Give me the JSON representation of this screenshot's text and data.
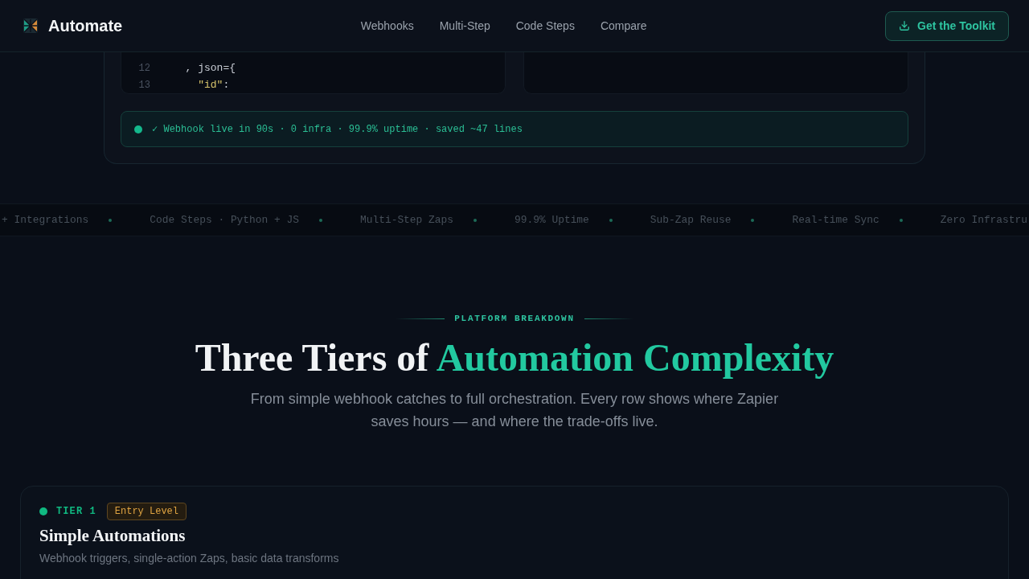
{
  "header": {
    "brand": "Automate",
    "nav": [
      {
        "label": "Webhooks"
      },
      {
        "label": "Multi-Step"
      },
      {
        "label": "Code Steps"
      },
      {
        "label": "Compare"
      }
    ],
    "cta": "Get the Toolkit"
  },
  "showcase": {
    "code_lines": [
      {
        "number": "12",
        "tokens": [
          {
            "kind": "plain",
            "text": "  , json={"
          }
        ]
      },
      {
        "number": "13",
        "tokens": [
          {
            "kind": "string",
            "text": "    \"id\""
          },
          {
            "kind": "plain",
            "text": ":"
          }
        ]
      }
    ],
    "status": "✓ Webhook live in 90s · 0 infra · 99.9% uptime · saved ~47 lines"
  },
  "ticker": [
    "+ Integrations",
    "Code Steps · Python + JS",
    "Multi-Step Zaps",
    "99.9% Uptime",
    "Sub-Zap Reuse",
    "Real-time Sync",
    "Zero Infrastru"
  ],
  "section": {
    "eyebrow": "PLATFORM BREAKDOWN",
    "title": "Three Tiers of",
    "title_accent": "Automation Complexity",
    "subtitle": "From simple webhook catches to full orchestration. Every row shows where Zapier saves hours — and where the trade-offs live."
  },
  "tiers": [
    {
      "label": "TIER 1",
      "color": "#10b981",
      "badge": "Entry Level",
      "title": "Simple Automations",
      "description": "Webhook triggers, single-action Zaps, basic data transforms"
    }
  ]
}
